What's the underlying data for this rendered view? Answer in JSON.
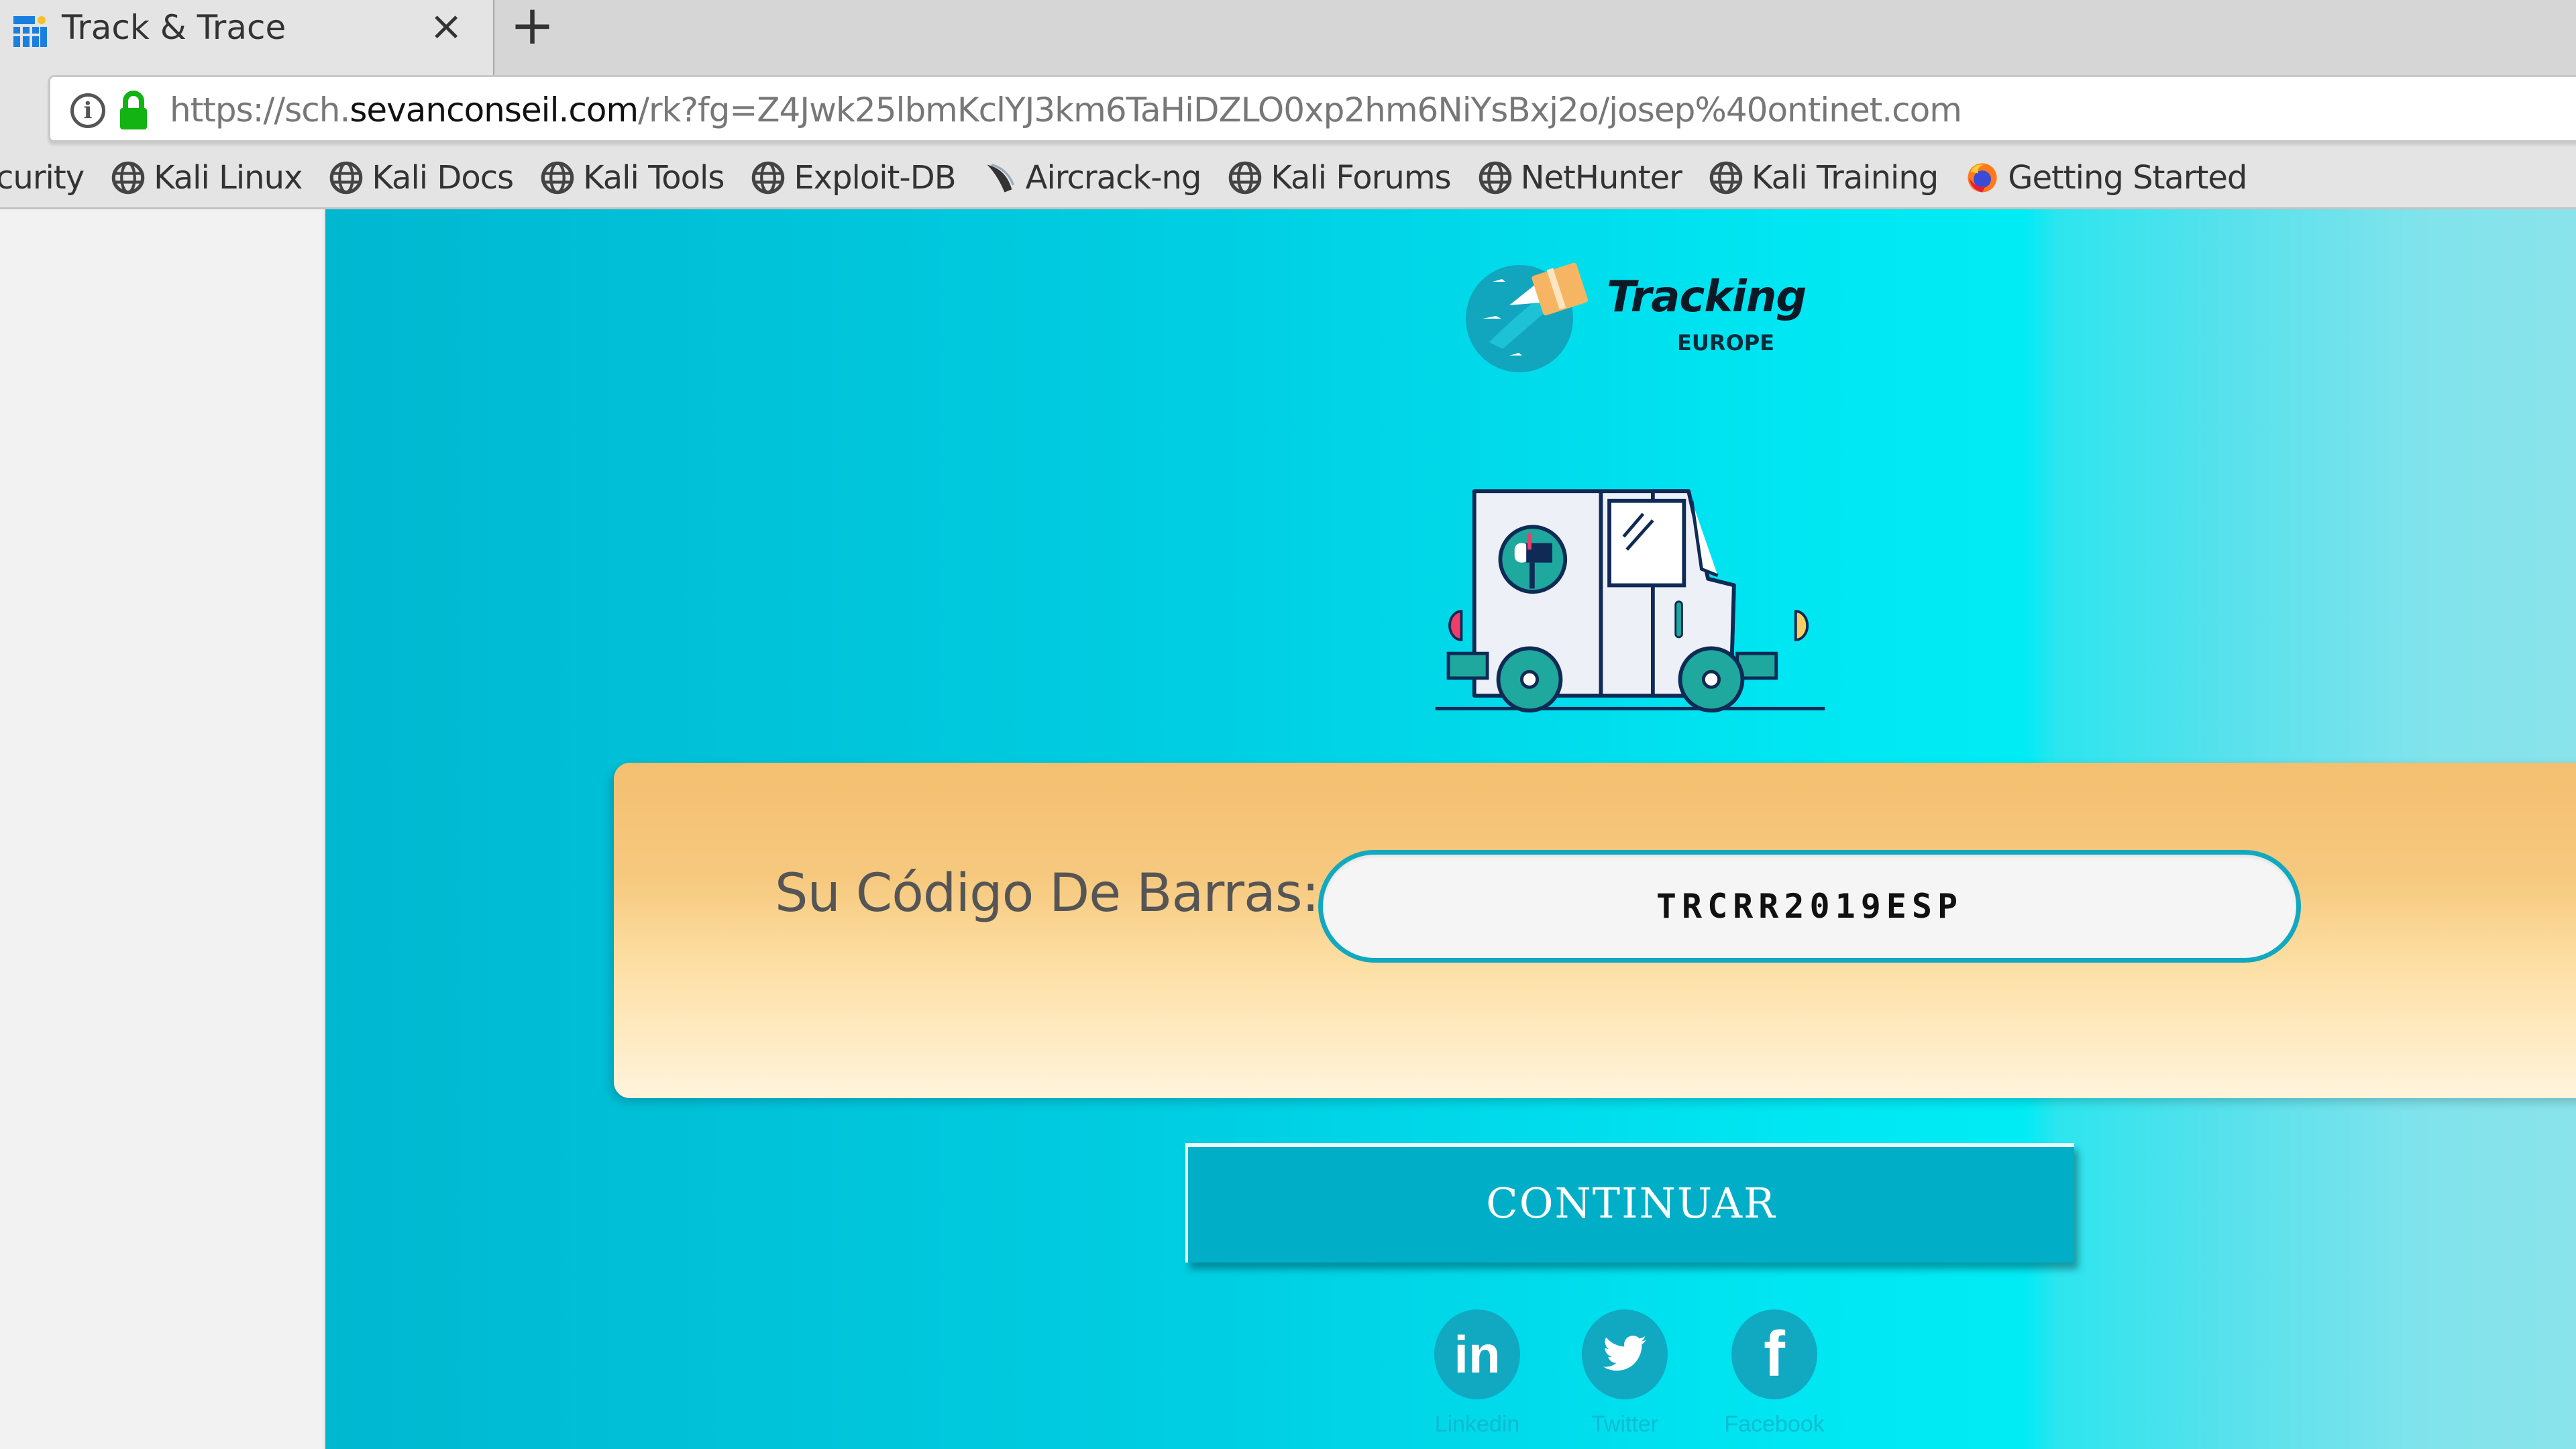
{
  "browser": {
    "tab": {
      "title": "Track & Trace",
      "close_glyph": "×",
      "favicon": "grid-icon"
    },
    "new_tab_glyph": "+",
    "url": {
      "prefix": "https://sch.",
      "domain": "sevanconseil.com",
      "path": "/rk?fg=Z4Jwk25lbmKclYJ3km6TaHiDZLO0xp2hm6NiYsBxj2o/josep%40ontinet.com",
      "secure": true
    },
    "bookmarks": [
      {
        "label": "curity",
        "icon": "none"
      },
      {
        "label": "Kali Linux",
        "icon": "globe-icon"
      },
      {
        "label": "Kali Docs",
        "icon": "globe-icon"
      },
      {
        "label": "Kali Tools",
        "icon": "globe-icon"
      },
      {
        "label": "Exploit-DB",
        "icon": "globe-icon"
      },
      {
        "label": "Aircrack-ng",
        "icon": "aircrack-icon"
      },
      {
        "label": "Kali Forums",
        "icon": "globe-icon"
      },
      {
        "label": "NetHunter",
        "icon": "globe-icon"
      },
      {
        "label": "Kali Training",
        "icon": "globe-icon"
      },
      {
        "label": "Getting Started",
        "icon": "firefox-icon"
      }
    ]
  },
  "page": {
    "logo": {
      "title": "Tracking",
      "subtitle": "EUROPE"
    },
    "form": {
      "label": "Su Código De Barras:",
      "barcode_value": "TRCRR2019ESP"
    },
    "continue_label": "CONTINUAR",
    "social": [
      {
        "label": "Linkedin",
        "icon": "linkedin-icon",
        "glyph": "in"
      },
      {
        "label": "Twitter",
        "icon": "twitter-icon",
        "glyph": ""
      },
      {
        "label": "Facebook",
        "icon": "facebook-icon",
        "glyph": "f"
      }
    ],
    "colors": {
      "page_bg": "#00d6e8",
      "card_top": "#f4bf70",
      "button": "#00aec8",
      "input_border": "#11a9bf",
      "social": "#11a9c2"
    }
  }
}
